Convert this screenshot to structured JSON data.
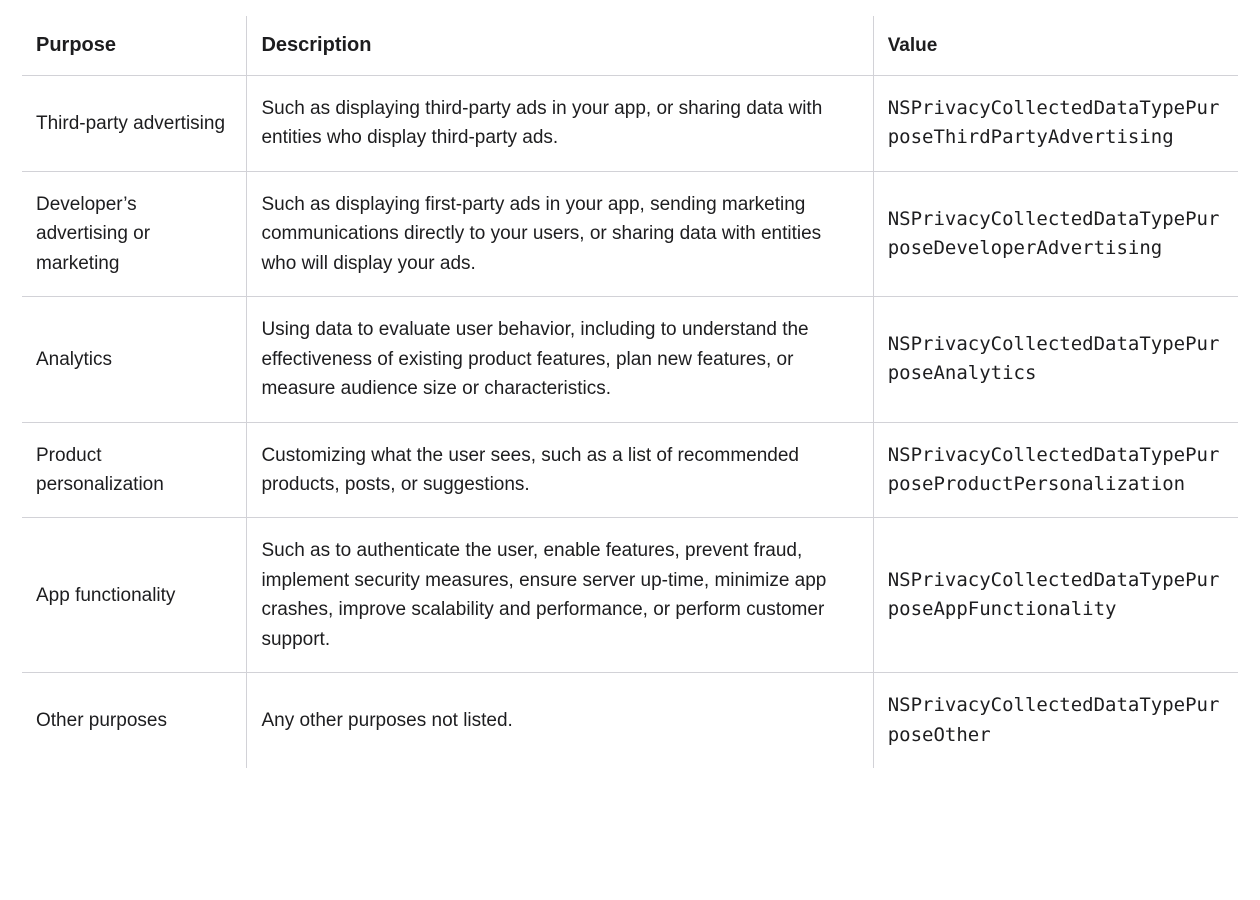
{
  "table": {
    "headers": {
      "purpose": "Purpose",
      "description": "Description",
      "value": "Value"
    },
    "rows": [
      {
        "purpose": "Third-party advertising",
        "description": "Such as displaying third-party ads in your app, or sharing data with entities who display third-party ads.",
        "value": "NSPrivacyCollectedDataTypePurposeThirdPartyAdvertising"
      },
      {
        "purpose": "Developer’s advertising or marketing",
        "description": "Such as displaying first-party ads in your app, sending marketing communications directly to your users, or sharing data with entities who will display your ads.",
        "value": "NSPrivacyCollectedDataTypePurposeDeveloperAdvertising"
      },
      {
        "purpose": "Analytics",
        "description": "Using data to evaluate user behavior, including to understand the effectiveness of existing product features, plan new features, or measure audience size or characteristics.",
        "value": "NSPrivacyCollectedDataTypePurposeAnalytics"
      },
      {
        "purpose": "Product personalization",
        "description": "Customizing what the user sees, such as a list of recommended products, posts, or suggestions.",
        "value": "NSPrivacyCollectedDataTypePurposeProductPersonalization"
      },
      {
        "purpose": "App functionality",
        "description": "Such as to authenticate the user, enable features, prevent fraud, implement security measures, ensure server up-time, minimize app crashes, improve scalability and performance, or perform customer support.",
        "value": "NSPrivacyCollectedDataTypePurposeAppFunctionality"
      },
      {
        "purpose": "Other purposes",
        "description": "Any other purposes not listed.",
        "value": "NSPrivacyCollectedDataTypePurposeOther"
      }
    ]
  }
}
